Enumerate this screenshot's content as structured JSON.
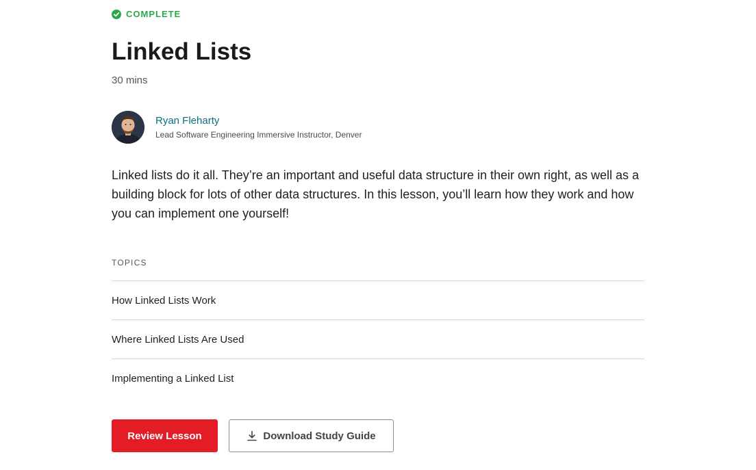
{
  "colors": {
    "complete_green": "#2aa84a",
    "link_teal": "#0b6e7e",
    "primary_red": "#e31c25"
  },
  "lesson": {
    "status_label": "COMPLETE",
    "status_icon": "check-circle-icon",
    "title": "Linked Lists",
    "duration": "30 mins",
    "description": "Linked lists do it all. They’re an important and useful data structure in their own right, as well as a building block for lots of other data structures. In this lesson, you’ll learn how they work and how you can implement one yourself!"
  },
  "instructor": {
    "avatar_icon": "avatar-photo",
    "name": "Ryan Fleharty",
    "role": "Lead Software Engineering Immersive Instructor, Denver"
  },
  "topics": {
    "heading": "TOPICS",
    "items": [
      {
        "label": "How Linked Lists Work"
      },
      {
        "label": "Where Linked Lists Are Used"
      },
      {
        "label": "Implementing a Linked List"
      }
    ]
  },
  "actions": {
    "review_label": "Review Lesson",
    "download_label": "Download Study Guide",
    "download_icon": "download-icon"
  }
}
